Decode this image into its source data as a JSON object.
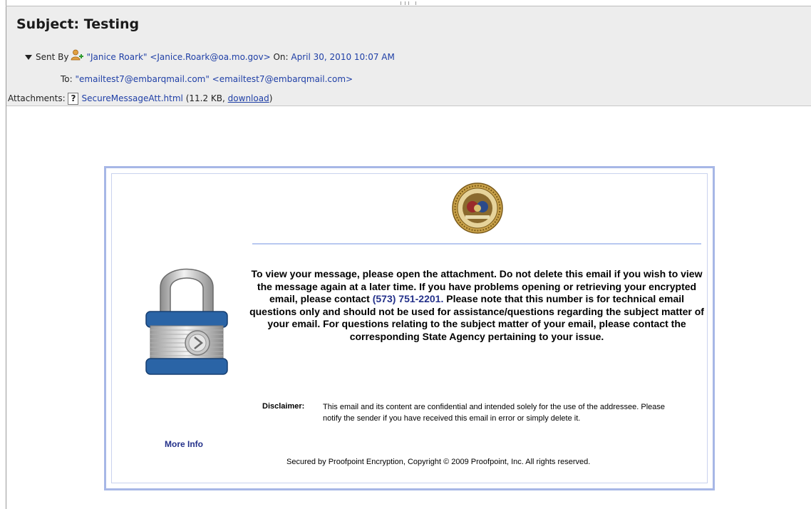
{
  "email": {
    "subject": "Subject: Testing",
    "sent_by_label": "Sent By",
    "sender": "\"Janice Roark\" <Janice.Roark@oa.mo.gov>",
    "on_label": "On:",
    "date": "April 30, 2010 10:07 AM",
    "to_label": "To:",
    "recipient": "\"emailtest7@embarqmail.com\" <emailtest7@embarqmail.com>",
    "attachments_label": "Attachments:",
    "attachment_name": "SecureMessageAtt.html",
    "attachment_size": "(11.2 KB, ",
    "download_label": "download",
    "attachment_close": ")"
  },
  "message": {
    "main_before_phone": "To view your message, please open the attachment. Do not delete this email if you wish to view the message again at a later time. If you have problems opening or retrieving your encrypted email, please contact ",
    "phone": "(573) 751-2201.",
    "main_after_phone": " Please note that this number is for technical email questions only and should not be used for assistance/questions regarding the subject matter of your email. For questions relating to the subject matter of your email, please contact the corresponding State Agency pertaining to your issue.",
    "disclaimer_label": "Disclaimer:",
    "disclaimer_text": "This email and its content are confidential and intended solely for the use of the addressee. Please notify the sender if you have received this email in error or simply delete it.",
    "more_info": "More Info",
    "copyright": "Secured by Proofpoint Encryption, Copyright © 2009 Proofpoint, Inc. All rights reserved."
  },
  "colors": {
    "header_bg": "#ededed",
    "link_blue": "#1f3fa6",
    "card_border": "#a7b7e6",
    "lock_blue": "#1f5c9e"
  },
  "icons": {
    "expand": "triangle-down-icon",
    "person": "add-contact-icon",
    "attachment": "unknown-file-icon",
    "seal": "missouri-seal-icon",
    "lock": "padlock-icon"
  }
}
